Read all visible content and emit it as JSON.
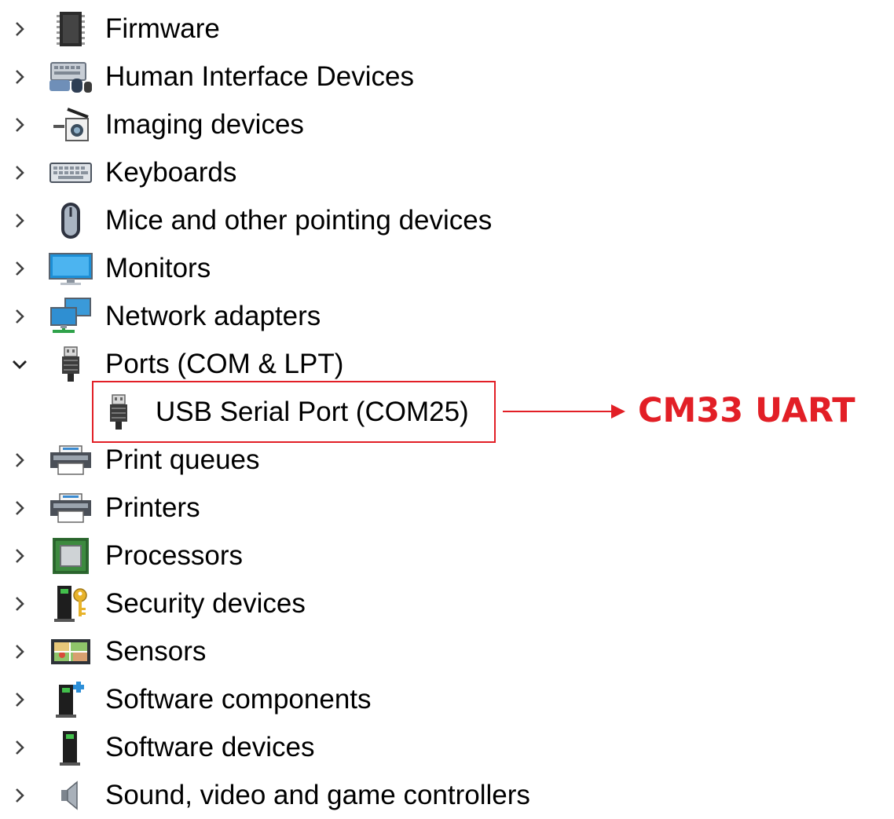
{
  "tree": {
    "items": [
      {
        "label": "Firmware",
        "icon": "firmware-chip-icon",
        "state": "collapsed"
      },
      {
        "label": "Human Interface Devices",
        "icon": "hid-keyboard-mouse-icon",
        "state": "collapsed"
      },
      {
        "label": "Imaging devices",
        "icon": "camera-icon",
        "state": "collapsed"
      },
      {
        "label": "Keyboards",
        "icon": "keyboard-icon",
        "state": "collapsed"
      },
      {
        "label": "Mice and other pointing devices",
        "icon": "mouse-icon",
        "state": "collapsed"
      },
      {
        "label": "Monitors",
        "icon": "monitor-icon",
        "state": "collapsed"
      },
      {
        "label": "Network adapters",
        "icon": "network-adapter-icon",
        "state": "collapsed"
      },
      {
        "label": "Ports (COM & LPT)",
        "icon": "port-connector-icon",
        "state": "expanded"
      },
      {
        "label": "USB Serial Port (COM25)",
        "icon": "port-connector-icon",
        "state": "child"
      },
      {
        "label": "Print queues",
        "icon": "printer-icon",
        "state": "collapsed"
      },
      {
        "label": "Printers",
        "icon": "printer-icon",
        "state": "collapsed"
      },
      {
        "label": "Processors",
        "icon": "processor-icon",
        "state": "collapsed"
      },
      {
        "label": "Security devices",
        "icon": "security-key-icon",
        "state": "collapsed"
      },
      {
        "label": "Sensors",
        "icon": "sensor-icon",
        "state": "collapsed"
      },
      {
        "label": "Software components",
        "icon": "software-component-icon",
        "state": "collapsed"
      },
      {
        "label": "Software devices",
        "icon": "software-device-icon",
        "state": "collapsed"
      },
      {
        "label": "Sound, video and game controllers",
        "icon": "speaker-icon",
        "state": "collapsed"
      }
    ]
  },
  "annotation": {
    "label": "CM33 UART",
    "color": "#e21f26"
  },
  "colors": {
    "highlight": "#e21f26",
    "chevron": "#404040"
  }
}
